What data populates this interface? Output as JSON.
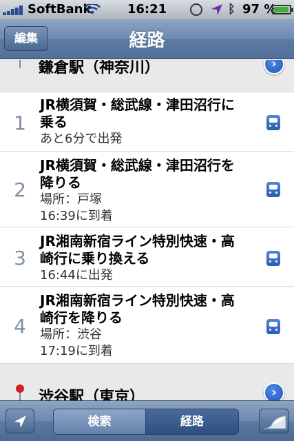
{
  "status_bar": {
    "carrier": "SoftBank",
    "time": "16:21",
    "battery_percent": "97 %",
    "battery_level": 0.97
  },
  "nav": {
    "edit_label": "編集",
    "title": "経路"
  },
  "start_station": {
    "name": "鎌倉駅（神奈川）"
  },
  "end_station": {
    "name": "渋谷駅（東京）"
  },
  "steps": [
    {
      "number": "1",
      "line1": "JR横須賀・総武線・津田沼行に",
      "line2": "乗る",
      "sub1": "あと6分で出発",
      "sub2": ""
    },
    {
      "number": "2",
      "line1": "JR横須賀・総武線・津田沼行を",
      "line2": "降りる",
      "sub1": "場所：戸塚",
      "sub2": "16:39に到着"
    },
    {
      "number": "3",
      "line1": "JR湘南新宿ライン特別快速・高",
      "line2": "崎行に乗り換える",
      "sub1": "16:44に出発",
      "sub2": ""
    },
    {
      "number": "4",
      "line1": "JR湘南新宿ライン特別快速・高",
      "line2": "崎行を降りる",
      "sub1": "場所：渋谷",
      "sub2": "17:19に到着"
    }
  ],
  "toolbar": {
    "search_label": "検索",
    "route_label": "経路"
  },
  "colors": {
    "start_pin": "#3aa83a",
    "end_pin": "#d42020",
    "accent": "#1f55b8"
  }
}
